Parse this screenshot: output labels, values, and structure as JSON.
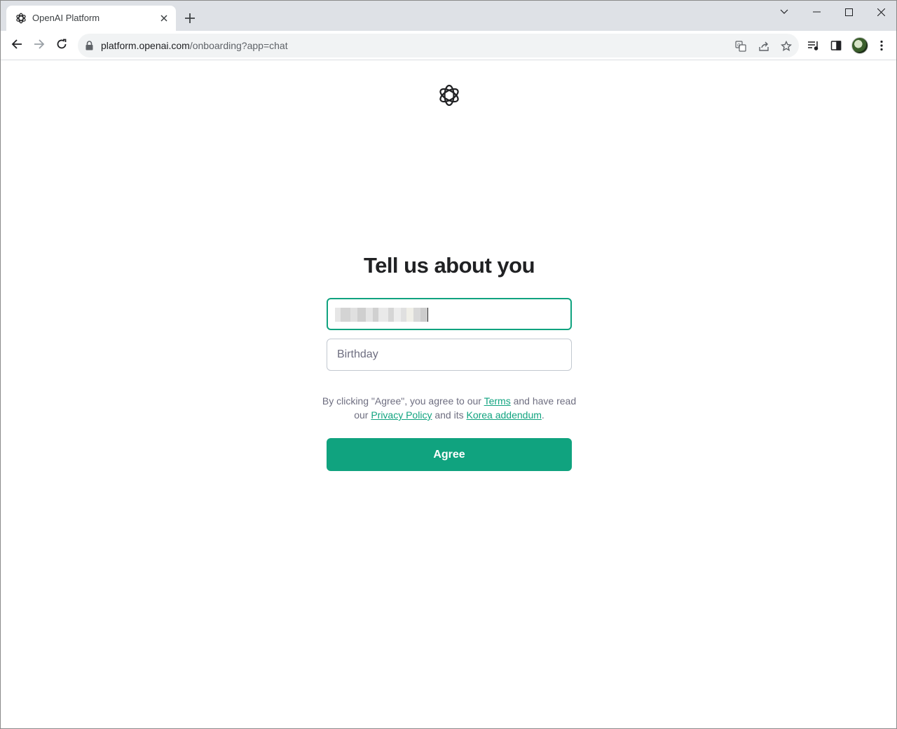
{
  "browser": {
    "tab": {
      "title": "OpenAI Platform",
      "favicon": "openai-logo-icon",
      "close_icon": "close-icon"
    },
    "new_tab_icon": "plus-icon",
    "window_controls": [
      "chevron-down-icon",
      "minimize-icon",
      "maximize-icon",
      "close-icon"
    ],
    "toolbar": {
      "back_icon": "arrow-left-icon",
      "forward_icon": "arrow-right-icon",
      "reload_icon": "reload-icon",
      "url_host": "platform.openai.com",
      "url_path": "/onboarding?app=chat",
      "omnibox_icons": [
        "translate-icon",
        "share-icon",
        "star-icon"
      ],
      "right_icons": [
        "media-control-icon",
        "side-panel-icon",
        "profile-avatar",
        "kebab-menu-icon"
      ]
    }
  },
  "page": {
    "logo": "openai-logo-icon",
    "heading": "Tell us about you",
    "name_field": {
      "value": "",
      "redacted": true
    },
    "birthday_field": {
      "placeholder": "Birthday",
      "value": ""
    },
    "legal": {
      "part1": "By clicking \"Agree\", you agree to our ",
      "terms_link": "Terms",
      "part2": " and have read our ",
      "privacy_link": "Privacy Policy",
      "part3": " and its ",
      "korea_link": "Korea addendum",
      "part4": "."
    },
    "agree_button": "Agree"
  },
  "colors": {
    "accent": "#10a37f",
    "tab_strip": "#dee1e6",
    "omnibox": "#f1f3f4",
    "heading_text": "#202123",
    "muted_text": "#6e6e80"
  }
}
